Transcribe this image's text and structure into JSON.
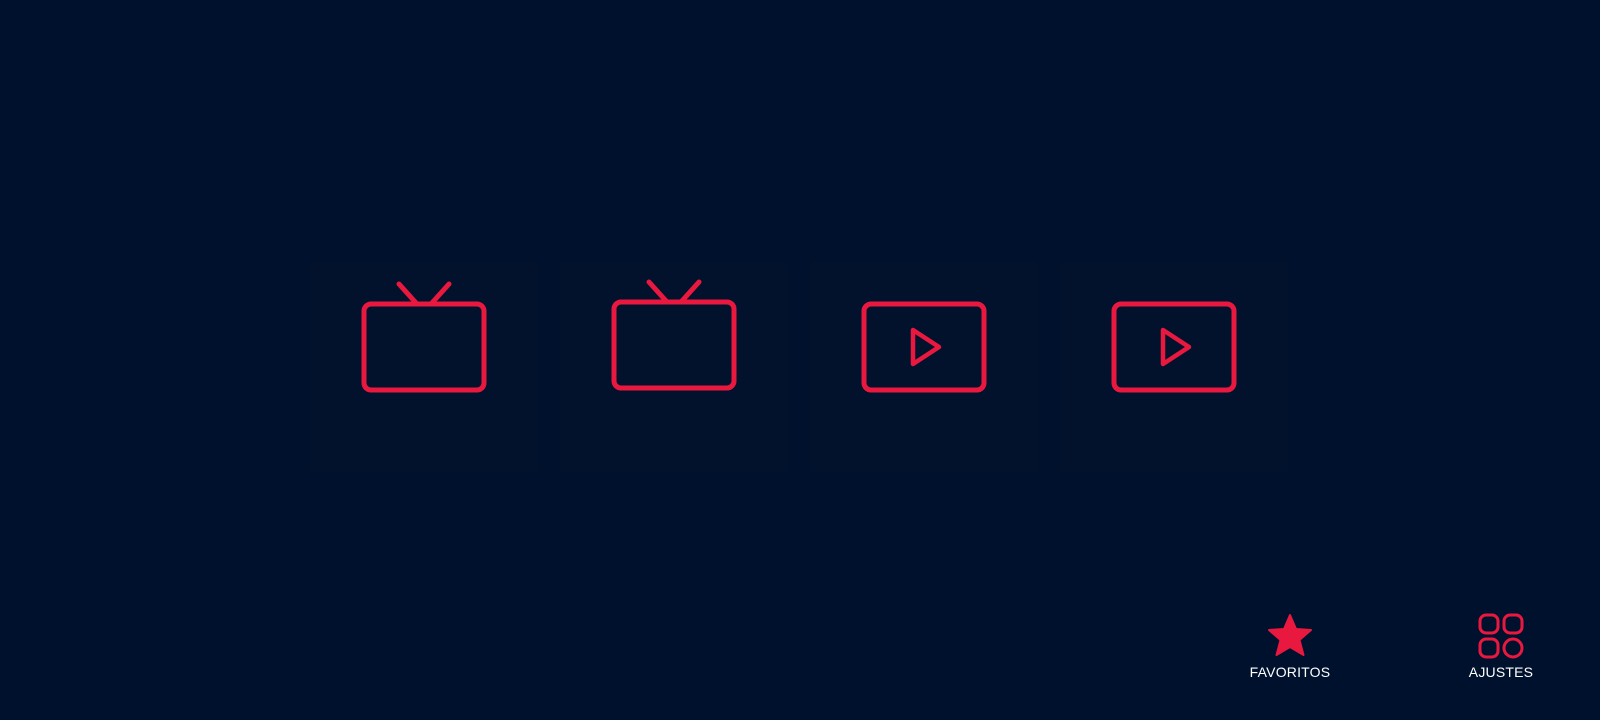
{
  "theme": {
    "background": "#00112e",
    "accent": "#e8183f",
    "text": "#ffffff"
  },
  "tiles": [
    {
      "icon": "tv-icon",
      "label": ""
    },
    {
      "icon": "tv-icon",
      "label": ""
    },
    {
      "icon": "video-play-icon",
      "label": ""
    },
    {
      "icon": "video-play-icon",
      "label": ""
    }
  ],
  "bottom_nav": {
    "favorites": {
      "icon": "star-icon",
      "label": "FAVORITOS"
    },
    "settings": {
      "icon": "grid-icon",
      "label": "AJUSTES"
    }
  }
}
